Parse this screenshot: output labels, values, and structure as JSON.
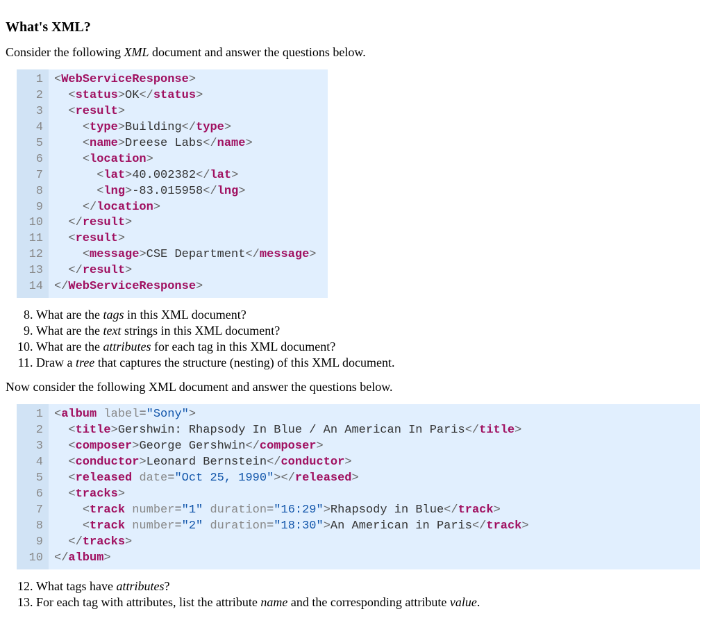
{
  "heading": "What's XML?",
  "intro1": "Consider the following XML document and answer the questions below.",
  "intro1_emword": "XML",
  "code1": [
    {
      "n": "1",
      "indent": 0,
      "open": "WebServiceResponse"
    },
    {
      "n": "2",
      "indent": 1,
      "open": "status",
      "text": "OK",
      "close": "status"
    },
    {
      "n": "3",
      "indent": 1,
      "open": "result"
    },
    {
      "n": "4",
      "indent": 2,
      "open": "type",
      "text": "Building",
      "close": "type"
    },
    {
      "n": "5",
      "indent": 2,
      "open": "name",
      "text": "Dreese Labs",
      "close": "name"
    },
    {
      "n": "6",
      "indent": 2,
      "open": "location"
    },
    {
      "n": "7",
      "indent": 3,
      "open": "lat",
      "text": "40.002382",
      "close": "lat"
    },
    {
      "n": "8",
      "indent": 3,
      "open": "lng",
      "text": "-83.015958",
      "close": "lng"
    },
    {
      "n": "9",
      "indent": 2,
      "closeOnly": "location"
    },
    {
      "n": "10",
      "indent": 1,
      "closeOnly": "result"
    },
    {
      "n": "11",
      "indent": 1,
      "open": "result"
    },
    {
      "n": "12",
      "indent": 2,
      "open": "message",
      "text": "CSE Department",
      "close": "message"
    },
    {
      "n": "13",
      "indent": 1,
      "closeOnly": "result"
    },
    {
      "n": "14",
      "indent": 0,
      "closeOnly": "WebServiceResponse"
    }
  ],
  "questionsA_start": 8,
  "questionsA": [
    {
      "pre": "What are the ",
      "em": "tags",
      "post": " in this XML document?"
    },
    {
      "pre": "What are the ",
      "em": "text",
      "post": " strings in this XML document?"
    },
    {
      "pre": "What are the ",
      "em": "attributes",
      "post": " for each tag in this XML document?"
    },
    {
      "pre": "Draw a ",
      "em": "tree",
      "post": " that captures the structure (nesting) of this XML document."
    }
  ],
  "intro2": "Now consider the following XML document and answer the questions below.",
  "code2": [
    {
      "n": "1",
      "indent": 0,
      "open": "album",
      "attrs": [
        {
          "name": "label",
          "value": "\"Sony\""
        }
      ]
    },
    {
      "n": "2",
      "indent": 1,
      "open": "title",
      "text": "Gershwin: Rhapsody In Blue / An American In Paris",
      "close": "title"
    },
    {
      "n": "3",
      "indent": 1,
      "open": "composer",
      "text": "George Gershwin",
      "close": "composer"
    },
    {
      "n": "4",
      "indent": 1,
      "open": "conductor",
      "text": "Leonard Bernstein",
      "close": "conductor"
    },
    {
      "n": "5",
      "indent": 1,
      "open": "released",
      "attrs": [
        {
          "name": "date",
          "value": "\"Oct 25, 1990\""
        }
      ],
      "close": "released"
    },
    {
      "n": "6",
      "indent": 1,
      "open": "tracks"
    },
    {
      "n": "7",
      "indent": 2,
      "open": "track",
      "attrs": [
        {
          "name": "number",
          "value": "\"1\""
        },
        {
          "name": "duration",
          "value": "\"16:29\""
        }
      ],
      "text": "Rhapsody in Blue",
      "close": "track"
    },
    {
      "n": "8",
      "indent": 2,
      "open": "track",
      "attrs": [
        {
          "name": "number",
          "value": "\"2\""
        },
        {
          "name": "duration",
          "value": "\"18:30\""
        }
      ],
      "text": "An American in Paris",
      "close": "track"
    },
    {
      "n": "9",
      "indent": 1,
      "closeOnly": "tracks"
    },
    {
      "n": "10",
      "indent": 0,
      "closeOnly": "album"
    }
  ],
  "questionsB_start": 12,
  "questionsB": [
    {
      "pre": "What tags have ",
      "em": "attributes",
      "post": "?"
    },
    {
      "pre": "For each tag with attributes, list the attribute ",
      "em": "name",
      "post": " and the corresponding attribute ",
      "em2": "value",
      "post2": "."
    }
  ]
}
